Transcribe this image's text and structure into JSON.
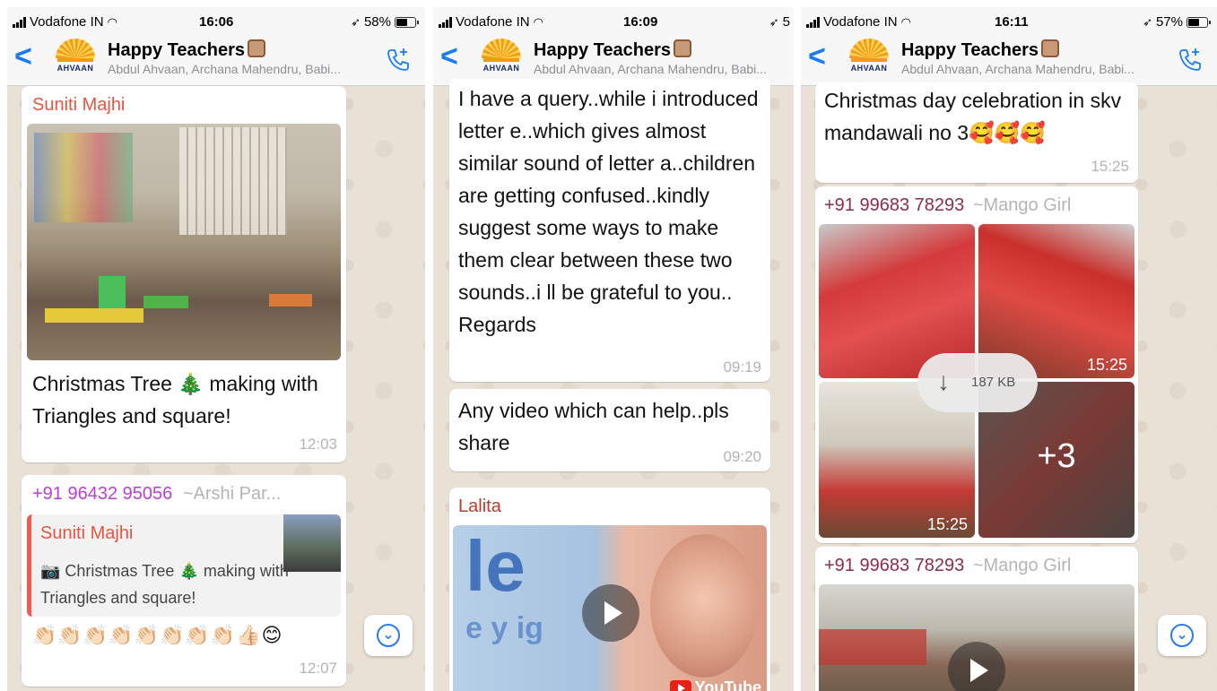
{
  "phone1": {
    "status": {
      "carrier": "Vodafone IN",
      "time": "16:06",
      "battery": "58%"
    },
    "header": {
      "back": "<",
      "group_name": "Happy Teachers",
      "members": "Abdul Ahvaan, Archana Mahendru, Babi...",
      "logo_text": "AHVAAN"
    },
    "msg1": {
      "sender": "Suniti Majhi",
      "caption": "Christmas Tree 🎄 making with Triangles and square!",
      "time": "12:03"
    },
    "msg2": {
      "sender": "+91 96432 95056",
      "sender_alias": "~Arshi Par...",
      "quote_sender": "Suniti Majhi",
      "quote_text": "📷 Christmas Tree 🎄 making with Triangles and square!",
      "reactions": "👏🏻👏🏻👏🏻👏🏻👏🏻👏🏻👏🏻👏🏻👍🏻😊",
      "time": "12:07"
    }
  },
  "phone2": {
    "status": {
      "carrier": "Vodafone IN",
      "time": "16:09",
      "battery": "5"
    },
    "header": {
      "back": "<",
      "group_name": "Happy Teachers",
      "members": "Abdul Ahvaan, Archana Mahendru, Babi...",
      "logo_text": "AHVAAN"
    },
    "msg1": {
      "text": "I have a query..while i introduced letter e..which gives almost similar sound of letter a..children are getting confused..kindly suggest some ways to make them clear between these two sounds..i ll be grateful to you.. Regards",
      "time": "09:19"
    },
    "msg2": {
      "text": "Any video which can help..pls share",
      "time": "09:20"
    },
    "msg3": {
      "sender": "Lalita",
      "video_text": "le",
      "video_text2": "e y ig",
      "brand": "YouTube"
    }
  },
  "phone3": {
    "status": {
      "carrier": "Vodafone IN",
      "time": "16:11",
      "battery": "57%"
    },
    "header": {
      "back": "<",
      "group_name": "Happy Teachers",
      "members": "Abdul Ahvaan, Archana Mahendru, Babi...",
      "logo_text": "AHVAAN"
    },
    "msg1": {
      "text": "Christmas day celebration in skv mandawali no 3🥰🥰🥰",
      "time": "15:25"
    },
    "msg2": {
      "sender": "+91 99683 78293",
      "sender_alias": "~Mango Girl",
      "download_size": "187 KB",
      "more_count": "+3",
      "time_top": "15:25",
      "time_bottom": "15:25"
    },
    "msg3": {
      "sender": "+91 99683 78293",
      "sender_alias": "~Mango Girl"
    }
  },
  "colors": {
    "accent": "#1a7cf5",
    "sender_red": "#e8543f",
    "sender_purple": "#b83fd2",
    "sender_maroon": "#8b2c4a",
    "chat_bg": "#ece5dd"
  }
}
